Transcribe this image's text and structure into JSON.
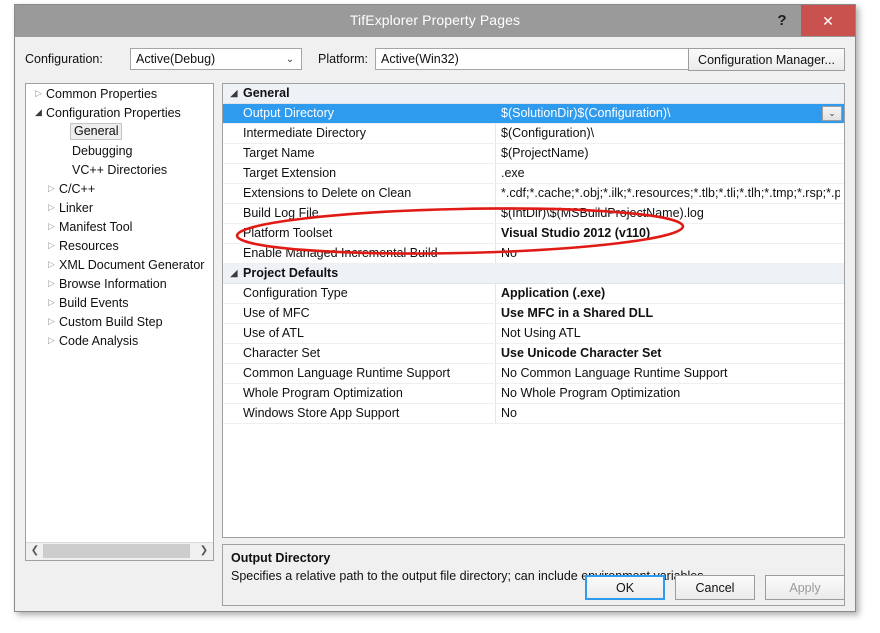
{
  "window": {
    "title": "TifExplorer Property Pages",
    "help_label": "?",
    "close_label": "✕"
  },
  "config_bar": {
    "configuration_label": "Configuration:",
    "configuration_value": "Active(Debug)",
    "platform_label": "Platform:",
    "platform_value": "Active(Win32)",
    "configuration_manager_label": "Configuration Manager...",
    "arrow_glyph": "⌄"
  },
  "tree": {
    "items": [
      {
        "label": "Common Properties",
        "indent": 0,
        "twisty": "collapsed",
        "selected": false
      },
      {
        "label": "Configuration Properties",
        "indent": 0,
        "twisty": "expanded",
        "selected": false
      },
      {
        "label": "General",
        "indent": 2,
        "twisty": "none",
        "selected": true
      },
      {
        "label": "Debugging",
        "indent": 2,
        "twisty": "none",
        "selected": false
      },
      {
        "label": "VC++ Directories",
        "indent": 2,
        "twisty": "none",
        "selected": false
      },
      {
        "label": "C/C++",
        "indent": 1,
        "twisty": "collapsed",
        "selected": false
      },
      {
        "label": "Linker",
        "indent": 1,
        "twisty": "collapsed",
        "selected": false
      },
      {
        "label": "Manifest Tool",
        "indent": 1,
        "twisty": "collapsed",
        "selected": false
      },
      {
        "label": "Resources",
        "indent": 1,
        "twisty": "collapsed",
        "selected": false
      },
      {
        "label": "XML Document Generator",
        "indent": 1,
        "twisty": "collapsed",
        "selected": false
      },
      {
        "label": "Browse Information",
        "indent": 1,
        "twisty": "collapsed",
        "selected": false
      },
      {
        "label": "Build Events",
        "indent": 1,
        "twisty": "collapsed",
        "selected": false
      },
      {
        "label": "Custom Build Step",
        "indent": 1,
        "twisty": "collapsed",
        "selected": false
      },
      {
        "label": "Code Analysis",
        "indent": 1,
        "twisty": "collapsed",
        "selected": false
      }
    ],
    "twisty_collapsed_glyph": "▷",
    "twisty_expanded_glyph": "◢",
    "scrollbar": {
      "left_arrow": "❮",
      "right_arrow": "❯"
    }
  },
  "grid": {
    "group_arrow_glyph": "◢",
    "dropdown_glyph": "⌄",
    "rows": [
      {
        "kind": "group",
        "name": "General"
      },
      {
        "kind": "prop",
        "name": "Output Directory",
        "value": "$(SolutionDir)$(Configuration)\\",
        "bold": false,
        "selected": true,
        "dropdown": true
      },
      {
        "kind": "prop",
        "name": "Intermediate Directory",
        "value": "$(Configuration)\\",
        "bold": false,
        "selected": false,
        "dropdown": false
      },
      {
        "kind": "prop",
        "name": "Target Name",
        "value": "$(ProjectName)",
        "bold": false,
        "selected": false,
        "dropdown": false
      },
      {
        "kind": "prop",
        "name": "Target Extension",
        "value": ".exe",
        "bold": false,
        "selected": false,
        "dropdown": false
      },
      {
        "kind": "prop",
        "name": "Extensions to Delete on Clean",
        "value": "*.cdf;*.cache;*.obj;*.ilk;*.resources;*.tlb;*.tli;*.tlh;*.tmp;*.rsp;*.pgc;*.pgd;*.meta",
        "bold": false,
        "selected": false,
        "dropdown": false
      },
      {
        "kind": "prop",
        "name": "Build Log File",
        "value": "$(IntDir)\\$(MSBuildProjectName).log",
        "bold": false,
        "selected": false,
        "dropdown": false
      },
      {
        "kind": "prop",
        "name": "Platform Toolset",
        "value": "Visual Studio 2012 (v110)",
        "bold": true,
        "selected": false,
        "dropdown": false
      },
      {
        "kind": "prop",
        "name": "Enable Managed Incremental Build",
        "value": "No",
        "bold": false,
        "selected": false,
        "dropdown": false
      },
      {
        "kind": "group",
        "name": "Project Defaults"
      },
      {
        "kind": "prop",
        "name": "Configuration Type",
        "value": "Application (.exe)",
        "bold": true,
        "selected": false,
        "dropdown": false
      },
      {
        "kind": "prop",
        "name": "Use of MFC",
        "value": "Use MFC in a Shared DLL",
        "bold": true,
        "selected": false,
        "dropdown": false
      },
      {
        "kind": "prop",
        "name": "Use of ATL",
        "value": "Not Using ATL",
        "bold": false,
        "selected": false,
        "dropdown": false
      },
      {
        "kind": "prop",
        "name": "Character Set",
        "value": "Use Unicode Character Set",
        "bold": true,
        "selected": false,
        "dropdown": false
      },
      {
        "kind": "prop",
        "name": "Common Language Runtime Support",
        "value": "No Common Language Runtime Support",
        "bold": false,
        "selected": false,
        "dropdown": false
      },
      {
        "kind": "prop",
        "name": "Whole Program Optimization",
        "value": "No Whole Program Optimization",
        "bold": false,
        "selected": false,
        "dropdown": false
      },
      {
        "kind": "prop",
        "name": "Windows Store App Support",
        "value": "No",
        "bold": false,
        "selected": false,
        "dropdown": false
      }
    ]
  },
  "description": {
    "title": "Output Directory",
    "text": "Specifies a relative path to the output file directory; can include environment variables."
  },
  "footer": {
    "ok_label": "OK",
    "cancel_label": "Cancel",
    "apply_label": "Apply"
  },
  "annotation": {
    "shape": "ellipse",
    "color": "#e01b15",
    "target_row": "Platform Toolset"
  },
  "colors": {
    "titlebar": "#9a9a9a",
    "close_button": "#c9524f",
    "selection": "#2f9bef",
    "group_header": "#eef2f7",
    "annotation_red": "#e01b15"
  }
}
